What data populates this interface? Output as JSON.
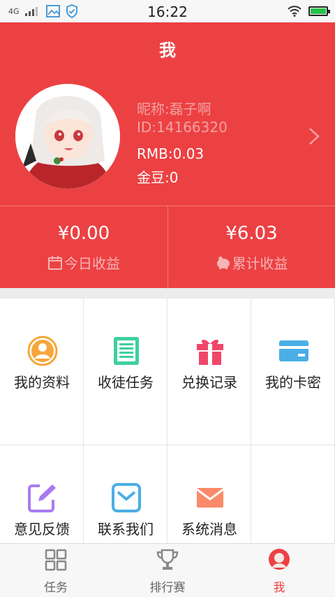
{
  "status_bar": {
    "network": "4G",
    "time": "16:22",
    "battery_level": 1.0
  },
  "header": {
    "title": "我"
  },
  "profile": {
    "nickname": "昵称:磊子啊",
    "id": "ID:14166320",
    "rmb": "RMB:0.03",
    "gold": "金豆:0"
  },
  "earnings": {
    "today_amount": "¥0.00",
    "today_label": "今日收益",
    "total_amount": "¥6.03",
    "total_label": "累计收益"
  },
  "menu": [
    {
      "label": "我的资料",
      "icon": "user-icon",
      "color": "#f7a63a"
    },
    {
      "label": "收徒任务",
      "icon": "document-list-icon",
      "color": "#3ecf9e"
    },
    {
      "label": "兑换记录",
      "icon": "gift-icon",
      "color": "#f0466a"
    },
    {
      "label": "我的卡密",
      "icon": "card-icon",
      "color": "#4aaee6"
    },
    {
      "label": "意见反馈",
      "icon": "edit-icon",
      "color": "#a77cf0"
    },
    {
      "label": "联系我们",
      "icon": "mail-icon",
      "color": "#4aaee6"
    },
    {
      "label": "系统消息",
      "icon": "envelope-icon",
      "color": "#fb8a6a"
    }
  ],
  "tabs": [
    {
      "label": "任务",
      "icon": "grid-icon"
    },
    {
      "label": "排行赛",
      "icon": "trophy-icon"
    },
    {
      "label": "我",
      "icon": "avatar-icon",
      "active": true
    }
  ],
  "colors": {
    "brand_red": "#ec4143",
    "active_tab": "#ec4143"
  }
}
